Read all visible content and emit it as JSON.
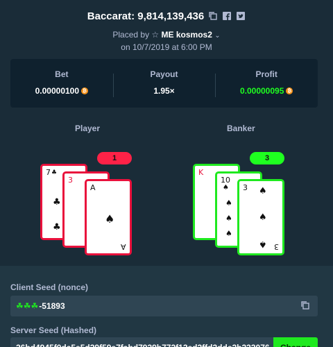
{
  "header": {
    "title": "Baccarat: 9,814,139,436",
    "placed_by_prefix": "Placed by",
    "username": "ME kosmos2",
    "date": "on 10/7/2019 at 6:00 PM",
    "icons": [
      "copy-icon",
      "facebook-icon",
      "twitter-icon",
      "star-icon",
      "chevron-down-icon"
    ]
  },
  "stats": {
    "bet_label": "Bet",
    "bet_value": "0.00000100",
    "payout_label": "Payout",
    "payout_value": "1.95×",
    "profit_label": "Profit",
    "profit_value": "0.00000095",
    "currency_icon": "bitcoin-icon",
    "profit_color": "#1fff20"
  },
  "player": {
    "label": "Player",
    "score": "1",
    "cards": [
      {
        "rank": "7",
        "suit": "♣",
        "color": "black"
      },
      {
        "rank": "3",
        "suit": "♦",
        "color": "red"
      },
      {
        "rank": "A",
        "suit": "♠",
        "color": "black"
      }
    ]
  },
  "banker": {
    "label": "Banker",
    "score": "3",
    "cards": [
      {
        "rank": "K",
        "suit": "♥",
        "color": "red"
      },
      {
        "rank": "10",
        "suit": "♠",
        "color": "black"
      },
      {
        "rank": "3",
        "suit": "♠",
        "color": "black"
      }
    ]
  },
  "seeds": {
    "client_label": "Client Seed (nonce)",
    "client_value": "-51893",
    "client_clovers": "☘☘☘",
    "server_label": "Server Seed (Hashed)",
    "server_value": "26bd4945f0da5e5d29f59e7fabd7939b772f12ed2ffd2dde2b233076",
    "change_label": "Change"
  },
  "colors": {
    "background": "#1a2c38",
    "panel": "#0f212e",
    "lose_border": "#e9113c",
    "win_border": "#1fe91f",
    "accent_green": "#1fff20",
    "accent_red": "#fe2247"
  }
}
